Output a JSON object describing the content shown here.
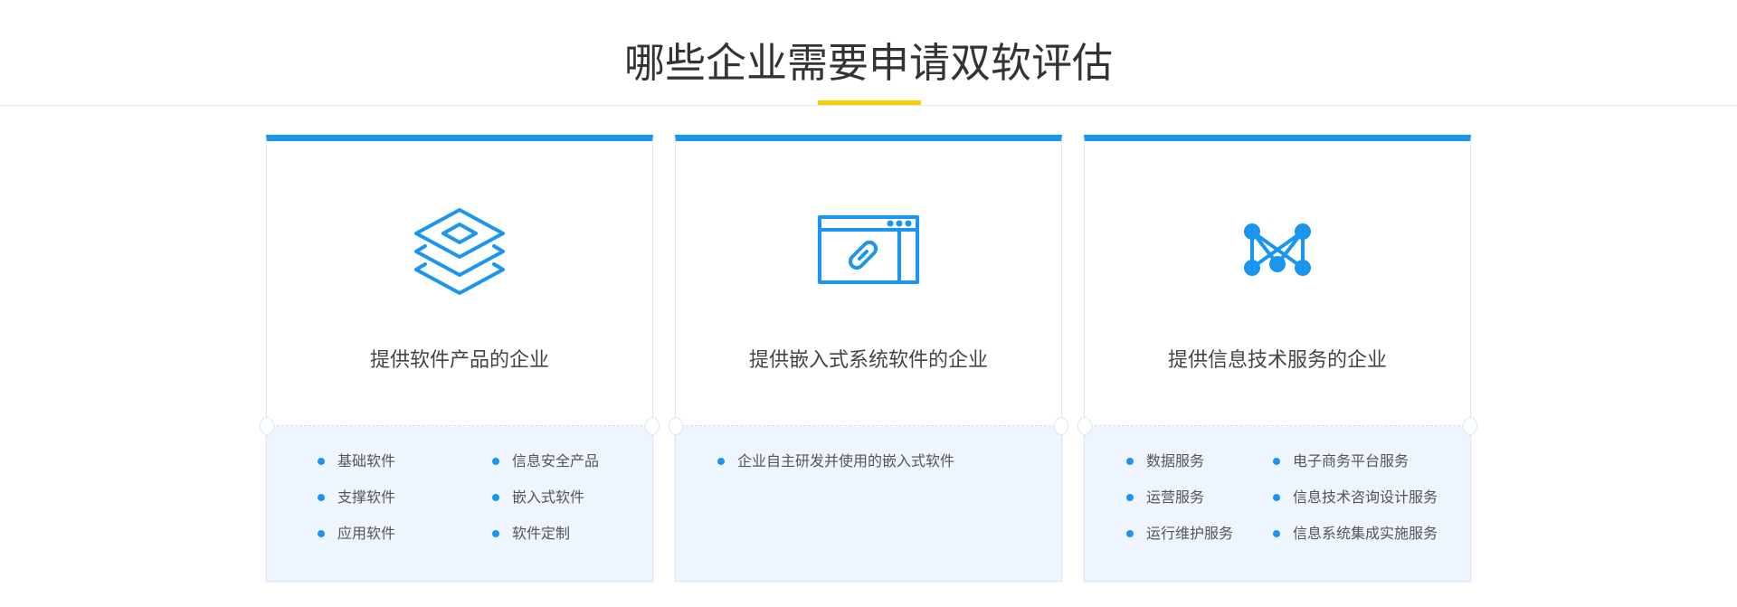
{
  "section": {
    "title": "哪些企业需要申请双软评估"
  },
  "colors": {
    "accent": "#1a96f0",
    "underline": "#f7d000",
    "card_bottom_bg": "#eef5fe"
  },
  "cards": [
    {
      "icon": "layers-icon",
      "title": "提供软件产品的企业",
      "items": [
        "基础软件",
        "信息安全产品",
        "支撑软件",
        "嵌入式软件",
        "应用软件",
        "软件定制"
      ]
    },
    {
      "icon": "browser-link-icon",
      "title": "提供嵌入式系统软件的企业",
      "items": [
        "企业自主研发并使用的嵌入式软件"
      ]
    },
    {
      "icon": "network-nodes-icon",
      "title": "提供信息技术服务的企业",
      "items": [
        "数据服务",
        "电子商务平台服务",
        "运营服务",
        "信息技术咨询设计服务",
        "运行维护服务",
        "信息系统集成实施服务"
      ]
    }
  ]
}
